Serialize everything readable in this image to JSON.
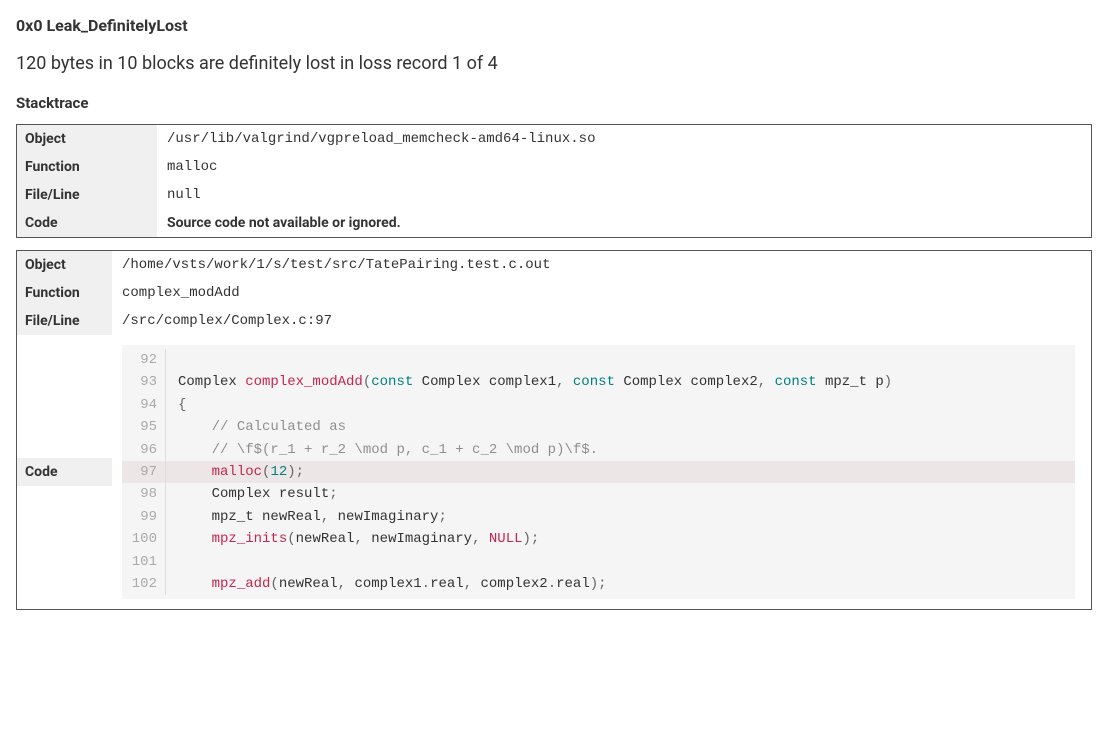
{
  "title": "0x0 Leak_DefinitelyLost",
  "summary": "120 bytes in 10 blocks are definitely lost in loss record 1 of 4",
  "section_stacktrace": "Stacktrace",
  "labels": {
    "object": "Object",
    "function": "Function",
    "file_line": "File/Line",
    "code": "Code"
  },
  "frames": [
    {
      "object": "/usr/lib/valgrind/vgpreload_memcheck-amd64-linux.so",
      "function": "malloc",
      "file_line": "null",
      "code_unavailable": "Source code not available or ignored."
    },
    {
      "object": "/home/vsts/work/1/s/test/src/TatePairing.test.c.out",
      "function": "complex_modAdd",
      "file_line": "/src/complex/Complex.c:97",
      "code_lines": [
        {
          "n": 92,
          "hl": false,
          "tokens": []
        },
        {
          "n": 93,
          "hl": false,
          "tokens": [
            {
              "t": "Complex ",
              "c": ""
            },
            {
              "t": "complex_modAdd",
              "c": "tok-type"
            },
            {
              "t": "(",
              "c": "tok-punct"
            },
            {
              "t": "const",
              "c": "tok-keyword"
            },
            {
              "t": " Complex complex1",
              "c": ""
            },
            {
              "t": ", ",
              "c": "tok-punct"
            },
            {
              "t": "const",
              "c": "tok-keyword"
            },
            {
              "t": " Complex complex2",
              "c": ""
            },
            {
              "t": ", ",
              "c": "tok-punct"
            },
            {
              "t": "const",
              "c": "tok-keyword"
            },
            {
              "t": " mpz_t p",
              "c": ""
            },
            {
              "t": ")",
              "c": "tok-punct"
            }
          ]
        },
        {
          "n": 94,
          "hl": false,
          "tokens": [
            {
              "t": "{",
              "c": "tok-punct"
            }
          ]
        },
        {
          "n": 95,
          "hl": false,
          "tokens": [
            {
              "t": "    ",
              "c": ""
            },
            {
              "t": "// Calculated as",
              "c": "tok-comment"
            }
          ]
        },
        {
          "n": 96,
          "hl": false,
          "tokens": [
            {
              "t": "    ",
              "c": ""
            },
            {
              "t": "// \\f$(r_1 + r_2 \\mod p, c_1 + c_2 \\mod p)\\f$.",
              "c": "tok-comment"
            }
          ]
        },
        {
          "n": 97,
          "hl": true,
          "tokens": [
            {
              "t": "    ",
              "c": ""
            },
            {
              "t": "malloc",
              "c": "tok-type"
            },
            {
              "t": "(",
              "c": "tok-punct"
            },
            {
              "t": "12",
              "c": "tok-number"
            },
            {
              "t": ");",
              "c": "tok-punct"
            }
          ]
        },
        {
          "n": 98,
          "hl": false,
          "tokens": [
            {
              "t": "    Complex result",
              "c": ""
            },
            {
              "t": ";",
              "c": "tok-punct"
            }
          ]
        },
        {
          "n": 99,
          "hl": false,
          "tokens": [
            {
              "t": "    mpz_t newReal",
              "c": ""
            },
            {
              "t": ", ",
              "c": "tok-punct"
            },
            {
              "t": "newImaginary",
              "c": ""
            },
            {
              "t": ";",
              "c": "tok-punct"
            }
          ]
        },
        {
          "n": 100,
          "hl": false,
          "tokens": [
            {
              "t": "    ",
              "c": ""
            },
            {
              "t": "mpz_inits",
              "c": "tok-type"
            },
            {
              "t": "(",
              "c": "tok-punct"
            },
            {
              "t": "newReal",
              "c": ""
            },
            {
              "t": ", ",
              "c": "tok-punct"
            },
            {
              "t": "newImaginary",
              "c": ""
            },
            {
              "t": ", ",
              "c": "tok-punct"
            },
            {
              "t": "NULL",
              "c": "tok-null"
            },
            {
              "t": ");",
              "c": "tok-punct"
            }
          ]
        },
        {
          "n": 101,
          "hl": false,
          "tokens": []
        },
        {
          "n": 102,
          "hl": false,
          "tokens": [
            {
              "t": "    ",
              "c": ""
            },
            {
              "t": "mpz_add",
              "c": "tok-type"
            },
            {
              "t": "(",
              "c": "tok-punct"
            },
            {
              "t": "newReal",
              "c": ""
            },
            {
              "t": ", ",
              "c": "tok-punct"
            },
            {
              "t": "complex1",
              "c": ""
            },
            {
              "t": ".",
              "c": "tok-punct"
            },
            {
              "t": "real",
              "c": ""
            },
            {
              "t": ", ",
              "c": "tok-punct"
            },
            {
              "t": "complex2",
              "c": ""
            },
            {
              "t": ".",
              "c": "tok-punct"
            },
            {
              "t": "real",
              "c": ""
            },
            {
              "t": ");",
              "c": "tok-punct"
            }
          ]
        }
      ]
    }
  ]
}
